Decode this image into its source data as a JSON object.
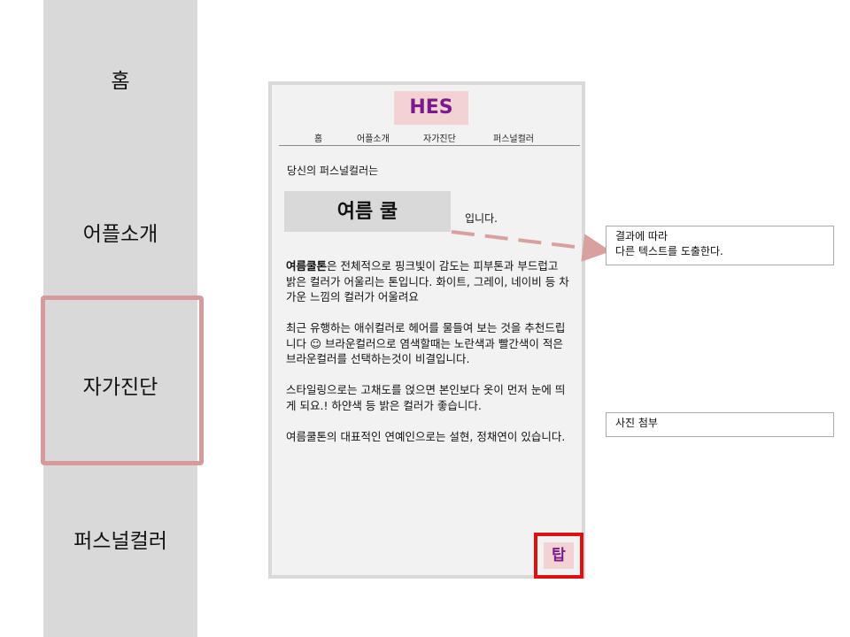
{
  "sidebar": {
    "items": [
      {
        "label": "홈"
      },
      {
        "label": "어플소개"
      },
      {
        "label": "자가진단"
      },
      {
        "label": "퍼스널컬러"
      }
    ]
  },
  "phone": {
    "logo": "HES",
    "nav": [
      "홈",
      "어플소개",
      "자가진단",
      "퍼스널컬러"
    ],
    "intro": "당신의 퍼스널컬러는",
    "result": "여름 쿨",
    "result_suffix": "입니다.",
    "desc": {
      "p1_bold": "여름쿨톤",
      "p1_rest": "은 전체적으로 핑크빛이 감도는 피부톤과 부드럽고 밝은 컬러가 어울리는 톤입니다. 화이트, 그레이, 네이비 등 차가운 느낌의 컬러가 어울려요",
      "p2": "최근 유행하는 애쉬컬러로 헤어를 물들여 보는 것을 추천드립니다 ☺ 브라운컬러으로 염색할때는 노란색과 빨간색이 적은 브라운컬러를 선택하는것이 비결입니다.",
      "p3": "스타일링으로는 고채도를 얹으면 본인보다 옷이 먼저 눈에 띄게 되요.! 하얀색 등 밝은 컬러가 좋습니다.",
      "p4": "여름쿨톤의 대표적인 연예인으로는 설현, 정채연이 있습니다."
    },
    "tip_label": "탑"
  },
  "notes": {
    "result_note_line1": "결과에 따라",
    "result_note_line2": "다른 텍스트를 도출한다.",
    "photo_note": "사진 첨부"
  },
  "colors": {
    "sidebar_bg": "#d9d9d9",
    "highlight_border": "#d69a9a",
    "logo_bg": "#f2d2d2",
    "logo_text": "#7a1a8c",
    "tip_border": "#dd1111",
    "arrow": "#d9a0a0"
  }
}
